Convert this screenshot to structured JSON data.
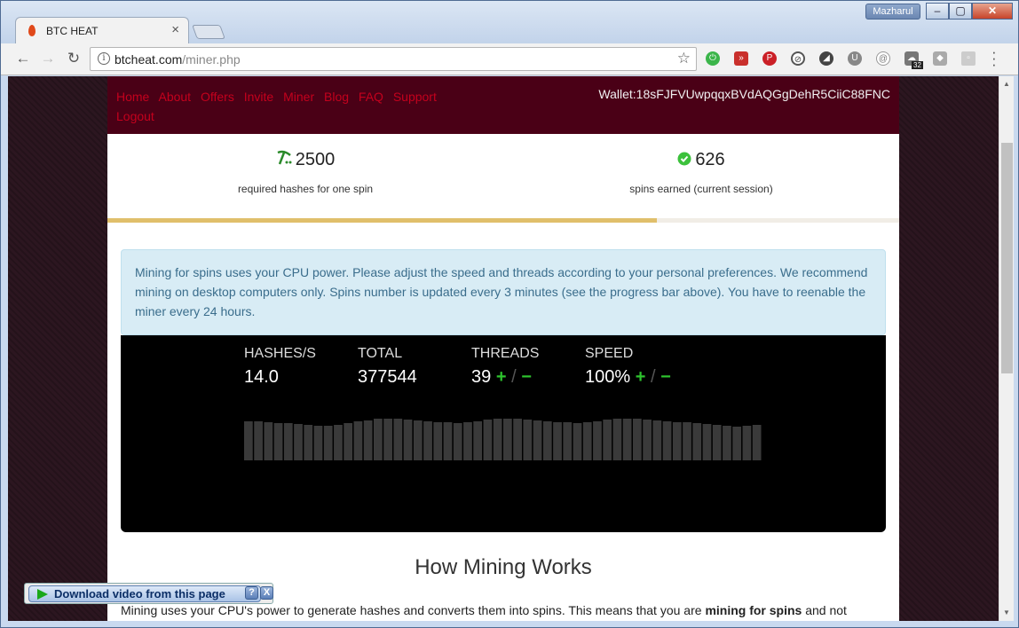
{
  "browser": {
    "tab_title": "BTC HEAT",
    "tab_close": "×",
    "user": "Mazharul",
    "window_buttons": [
      "‒",
      "▢",
      "✕"
    ],
    "url_host": "btcheat.com",
    "url_path": "/miner.php",
    "extension_badge": "32"
  },
  "site": {
    "nav": [
      "Home",
      "About",
      "Offers",
      "Invite",
      "Miner",
      "Blog",
      "FAQ",
      "Support",
      "Logout"
    ],
    "wallet_label": "Wallet:",
    "wallet_address": "18sFJFVUwpqqxBVdAQGgDehR5CiiC88FNC"
  },
  "stats": {
    "required_hashes": "2500",
    "required_hashes_label": "required hashes for one spin",
    "spins": "626",
    "spins_label": "spins earned (current session)",
    "progress_fraction": 0.694
  },
  "alert": {
    "text": "Mining for spins uses your CPU power. Please adjust the speed and threads according to your personal preferences. We recommend mining on desktop computers only. Spins number is updated every 3 minutes (see the progress bar above). You have to reenable the miner every 24 hours."
  },
  "miner": {
    "hashes_label": "HASHES/S",
    "hashes_value": "14.0",
    "total_label": "TOTAL",
    "total_value": "377544",
    "threads_label": "THREADS",
    "threads_value": "39",
    "speed_label": "SPEED",
    "speed_value": "100%",
    "plus": "+",
    "slash": "/",
    "minus": "−",
    "history": [
      44,
      44,
      43,
      42,
      42,
      41,
      40,
      39,
      39,
      40,
      42,
      44,
      45,
      47,
      47,
      47,
      46,
      45,
      44,
      43,
      43,
      42,
      43,
      44,
      46,
      47,
      47,
      47,
      46,
      45,
      44,
      43,
      43,
      42,
      43,
      44,
      46,
      47,
      47,
      47,
      46,
      45,
      44,
      43,
      43,
      42,
      41,
      40,
      39,
      38,
      39,
      40
    ]
  },
  "content": {
    "heading": "How Mining Works",
    "para_start": "Mining uses your CPU's power to generate hashes and converts them into spins. This means that you are ",
    "para_bold": "mining for spins",
    "para_end": " and not"
  },
  "download_bar": {
    "label": "Download video from this page",
    "help": "?",
    "close": "X"
  }
}
